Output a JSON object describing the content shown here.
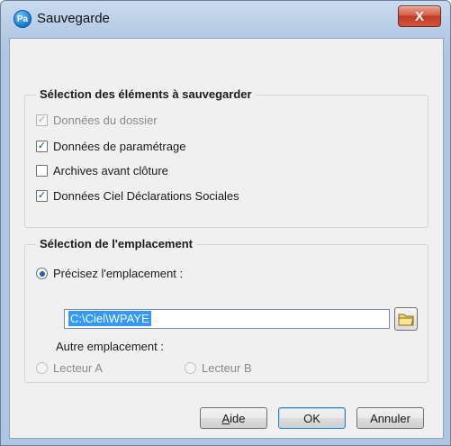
{
  "window": {
    "title": "Sauvegarde",
    "app_icon_text": "Pa",
    "close_glyph": "X"
  },
  "elements_group": {
    "title": "Sélection des éléments à sauvegarder",
    "items": [
      {
        "label": "Données du dossier",
        "checked": true,
        "disabled": true
      },
      {
        "label": "Données de paramétrage",
        "checked": true,
        "disabled": false
      },
      {
        "label": "Archives avant clôture",
        "checked": false,
        "disabled": false
      },
      {
        "label": "Données Ciel Déclarations Sociales",
        "checked": true,
        "disabled": false
      }
    ]
  },
  "location_group": {
    "title": "Sélection de l'emplacement",
    "radio_precise_label": "Précisez l'emplacement :",
    "path_value": "C:\\Ciel\\WPAYE",
    "other_label": "Autre emplacement :",
    "reader_a_label": "Lecteur A",
    "reader_b_label": "Lecteur B"
  },
  "buttons": {
    "help_first": "A",
    "help_rest": "ide",
    "ok": "OK",
    "cancel": "Annuler"
  },
  "icons": {
    "app": "app-icon",
    "close": "close-icon",
    "folder": "folder-icon",
    "check": "check-icon"
  }
}
